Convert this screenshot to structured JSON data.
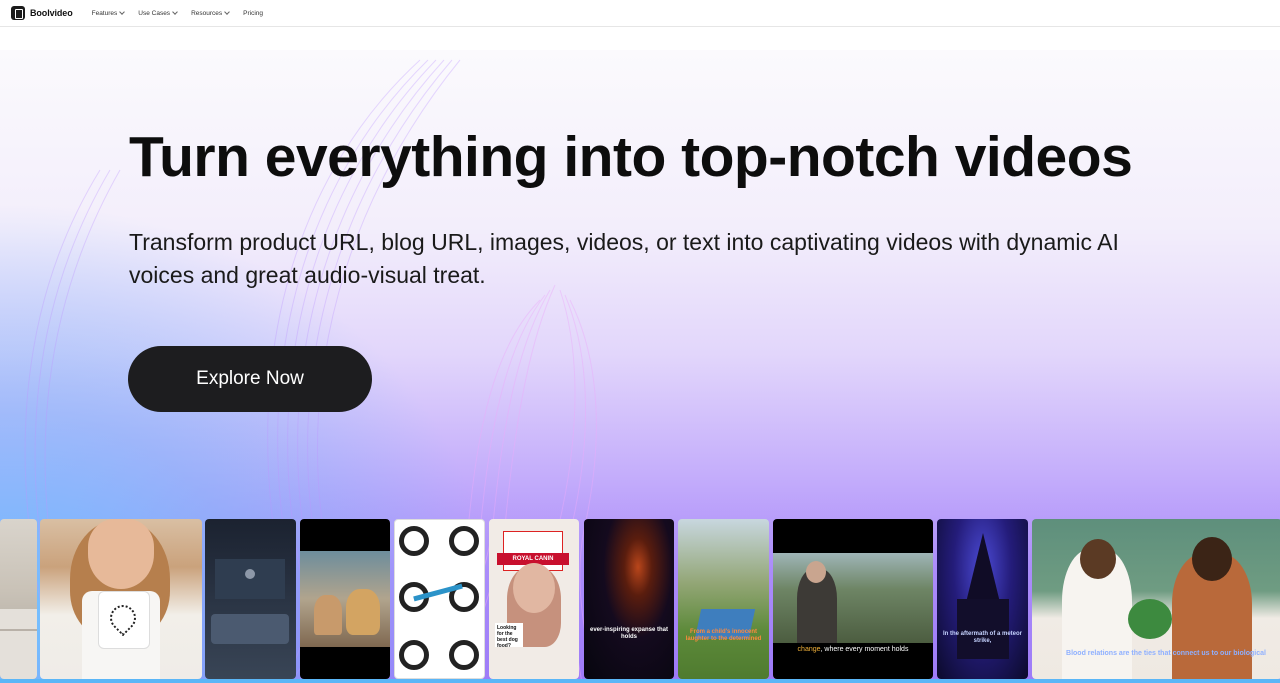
{
  "nav": {
    "brand": "Boolvideo",
    "items": [
      {
        "label": "Features",
        "has_dropdown": true
      },
      {
        "label": "Use Cases",
        "has_dropdown": true
      },
      {
        "label": "Resources",
        "has_dropdown": true
      },
      {
        "label": "Pricing",
        "has_dropdown": false
      }
    ]
  },
  "hero": {
    "title": "Turn everything into top-notch videos",
    "subtitle": "Transform product URL, blog URL, images, videos, or text into captivating videos with dynamic AI voices and great audio-visual treat.",
    "cta_label": "Explore Now"
  },
  "gallery": {
    "cards": [
      {
        "subject": "kitchen interior",
        "caption": ""
      },
      {
        "subject": "woman holding paw print mug",
        "caption": ""
      },
      {
        "subject": "dark living room",
        "caption": ""
      },
      {
        "subject": "woman with dog in car",
        "caption": ""
      },
      {
        "subject": "mountain bikes",
        "caption": ""
      },
      {
        "subject": "woman with Royal Canin dog food",
        "caption": "Looking for the best dog food?",
        "banner": "ROYAL CANIN"
      },
      {
        "subject": "space nebula",
        "caption": "ever-inspiring expanse that holds"
      },
      {
        "subject": "girls on trampoline",
        "caption": "From a child's innocent laughter to the determined"
      },
      {
        "subject": "elderly man in cemetery",
        "caption": "change, where every moment holds",
        "caption_highlight": "change"
      },
      {
        "subject": "dark castle with lightning",
        "caption": "In the aftermath of a meteor strike,"
      },
      {
        "subject": "family with broccoli",
        "caption": "Blood relations are the ties that connect us to our biological"
      }
    ]
  },
  "colors": {
    "cta_bg": "#1d1d1f",
    "hero_gradient_bottom": "#9d7af8",
    "accent_blue": "#5bb6f7"
  }
}
